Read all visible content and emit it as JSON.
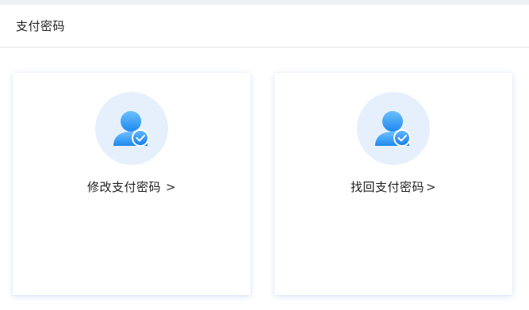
{
  "header": {
    "title": "支付密码"
  },
  "cards": [
    {
      "label": "修改支付密码",
      "arrow": ">",
      "icon": "user-check-icon"
    },
    {
      "label": "找回支付密码",
      "arrow": ">",
      "icon": "user-check-icon"
    }
  ],
  "colors": {
    "icon_circle_bg": "#e6f0fd",
    "icon_blue_light": "#5cb6ff",
    "icon_blue_dark": "#1e8bf0"
  }
}
